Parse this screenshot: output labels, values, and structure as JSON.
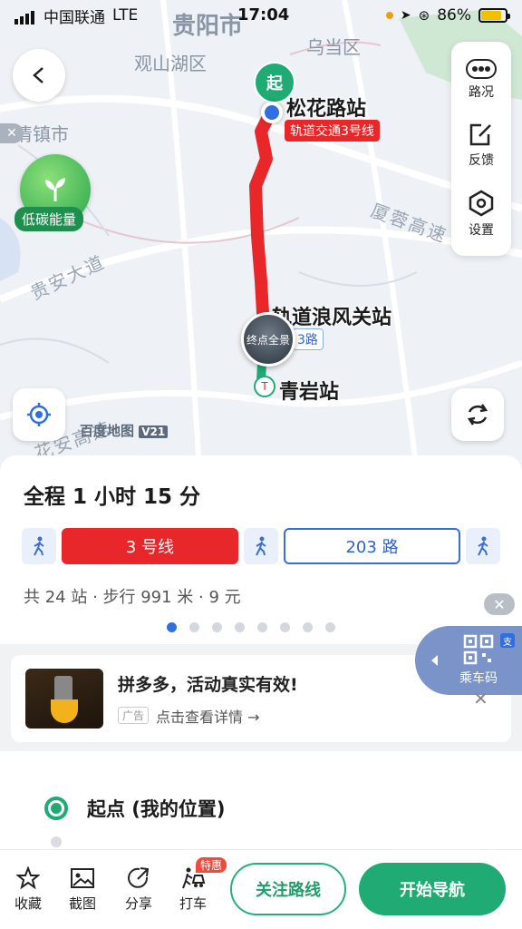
{
  "status_bar": {
    "carrier": "中国联通",
    "network": "LTE",
    "time": "17:04",
    "battery": "86%"
  },
  "map": {
    "city_labels": [
      "贵阳市",
      "乌当区",
      "观山湖区",
      "清镇市"
    ],
    "road_labels": [
      "贵安大道",
      "厦蓉高速",
      "花安高速"
    ],
    "low_carbon_label": "低碳能量",
    "start_marker": "起",
    "start_station": "松花路站",
    "metro_tag": "轨道交通3号线",
    "transfer_station": "轨道浪风关站",
    "bus_tag_suffix": "3路",
    "end_preview": "终点全景",
    "end_station": "青岩站",
    "watermark": "百度地图",
    "watermark_version": "V21",
    "route_color": "#e8272a",
    "start_color": "#1fab73"
  },
  "side_panel": {
    "traffic": "路况",
    "feedback": "反馈",
    "settings": "设置"
  },
  "route": {
    "duration": "全程 1 小时 15 分",
    "metro_segment": "3 号线",
    "bus_segment": "203 路",
    "summary": "共 24 站 · 步行 991 米 · 9 元",
    "page_count": 8,
    "current_page": 1
  },
  "ad": {
    "title": "拼多多，活动真实有效!",
    "badge": "广告",
    "link": "点击查看详情 →"
  },
  "qr_widget": {
    "label": "乘车码"
  },
  "start_point": "起点 (我的位置)",
  "toolbar": {
    "favorite": "收藏",
    "screenshot": "截图",
    "share": "分享",
    "taxi": "打车",
    "taxi_badge": "特惠",
    "follow": "关注路线",
    "navigate": "开始导航"
  }
}
